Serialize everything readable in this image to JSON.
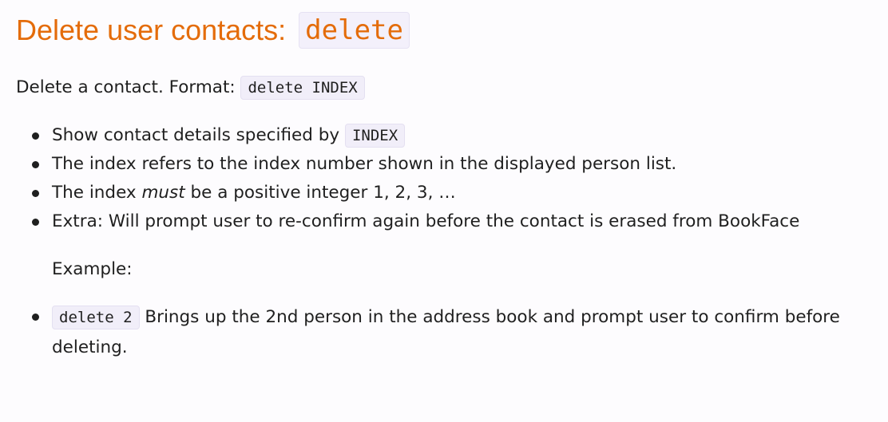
{
  "heading": {
    "text": "Delete user contacts: ",
    "command": "delete"
  },
  "intro": {
    "text": "Delete a contact. Format: ",
    "format": "delete INDEX"
  },
  "bullets": [
    {
      "before": "Show contact details specified by ",
      "code": "INDEX"
    },
    {
      "text": "The index refers to the index number shown in the displayed person list."
    },
    {
      "before": "The index ",
      "emphasis": "must",
      "after": " be a positive integer 1, 2, 3, …"
    },
    {
      "text": "Extra: Will prompt user to re-confirm again before the contact is erased from BookFace"
    }
  ],
  "example_label": "Example:",
  "examples": [
    {
      "code": "delete 2",
      "text": " Brings up the 2nd person in the address book and prompt user to confirm before deleting."
    }
  ],
  "colors": {
    "heading": "#e46c0a",
    "code_background": "#f1eef9",
    "text": "#1f1f1f"
  }
}
